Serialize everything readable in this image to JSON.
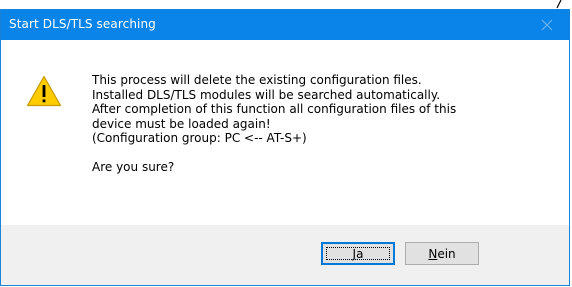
{
  "dialog": {
    "title": "Start DLS/TLS searching",
    "message_lines": [
      "This process will delete the existing configuration files.",
      "Installed DLS/TLS modules will be searched automatically.",
      "After completion of this function all configuration files of this",
      "device must be loaded again!",
      "(Configuration group: PC <-- AT-S+)"
    ],
    "question": "Are you sure?",
    "icon": "warning-icon",
    "buttons": {
      "ja": {
        "mnemonic": "J",
        "rest": "a"
      },
      "nein": {
        "mnemonic": "N",
        "rest": "ein"
      }
    }
  },
  "colors": {
    "titlebar": "#0a84e8",
    "title_text": "#ffffff",
    "button_bar": "#f0f0f0",
    "default_button_border": "#0078d7",
    "warning_fill": "#ffcc00"
  }
}
